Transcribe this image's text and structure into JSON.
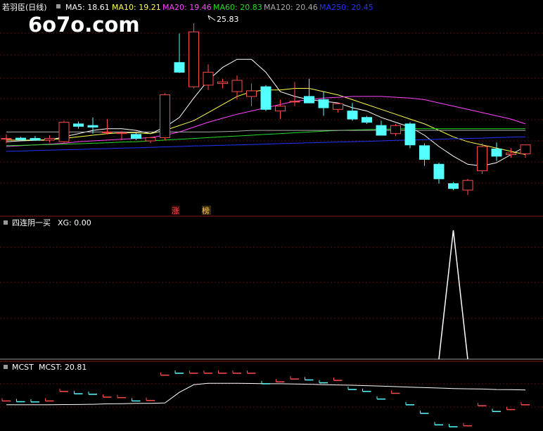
{
  "colors": {
    "background": "#000000",
    "up": "#ff4b4b",
    "down": "#54ffff",
    "ma5": "#ffffff",
    "ma10": "#ffff4d",
    "ma20": "#ff44ff",
    "ma60": "#22dd22",
    "ma120": "#aaaaaa",
    "ma250": "#2233ff",
    "divider": "#8b1a1a",
    "grid": "#5a1010"
  },
  "watermark": "6o7o.com",
  "main_panel": {
    "title": "若羽臣(日线)",
    "legends": [
      {
        "key": "ma5",
        "text": "MA5: 18.61"
      },
      {
        "key": "ma10",
        "text": "MA10: 19.21"
      },
      {
        "key": "ma20",
        "text": "MA20: 19.46"
      },
      {
        "key": "ma60",
        "text": "MA60: 20.83"
      },
      {
        "key": "ma120",
        "text": "MA120: 20.46"
      },
      {
        "key": "ma250",
        "text": "MA250: 20.45"
      }
    ],
    "high_annotation": "25.83",
    "event_marks": [
      "涨",
      "榜"
    ]
  },
  "indicator_panel": {
    "title": "四连阴一买",
    "legend": "XG: 0.00"
  },
  "mcst_panel": {
    "title": "MCST",
    "legend": "MCST: 20.81"
  },
  "chart_data": {
    "type": "candlestick",
    "price_range": [
      14.8,
      26.4
    ],
    "candles": [
      {
        "o": 18.65,
        "h": 18.95,
        "l": 18.4,
        "c": 18.7
      },
      {
        "o": 18.72,
        "h": 18.8,
        "l": 18.55,
        "c": 18.62
      },
      {
        "o": 18.7,
        "h": 18.85,
        "l": 18.55,
        "c": 18.6
      },
      {
        "o": 18.6,
        "h": 18.9,
        "l": 18.45,
        "c": 18.7
      },
      {
        "o": 18.5,
        "h": 19.8,
        "l": 18.4,
        "c": 19.7
      },
      {
        "o": 19.6,
        "h": 19.75,
        "l": 19.3,
        "c": 19.45
      },
      {
        "o": 19.5,
        "h": 20.0,
        "l": 19.0,
        "c": 19.4
      },
      {
        "o": 19.05,
        "h": 19.9,
        "l": 18.95,
        "c": 19.1
      },
      {
        "o": 19.0,
        "h": 19.15,
        "l": 18.6,
        "c": 19.05
      },
      {
        "o": 18.95,
        "h": 19.1,
        "l": 18.6,
        "c": 18.7
      },
      {
        "o": 18.55,
        "h": 18.8,
        "l": 18.4,
        "c": 18.75
      },
      {
        "o": 18.75,
        "h": 21.5,
        "l": 18.6,
        "c": 21.4
      },
      {
        "o": 23.4,
        "h": 25.2,
        "l": 22.75,
        "c": 22.8
      },
      {
        "o": 21.9,
        "h": 25.83,
        "l": 21.8,
        "c": 25.3
      },
      {
        "o": 22.0,
        "h": 23.3,
        "l": 21.7,
        "c": 22.8
      },
      {
        "o": 22.1,
        "h": 22.4,
        "l": 21.8,
        "c": 22.2
      },
      {
        "o": 21.6,
        "h": 22.6,
        "l": 21.1,
        "c": 22.3
      },
      {
        "o": 21.3,
        "h": 22.1,
        "l": 20.7,
        "c": 21.65
      },
      {
        "o": 21.9,
        "h": 22.0,
        "l": 20.4,
        "c": 20.5
      },
      {
        "o": 20.4,
        "h": 21.1,
        "l": 19.9,
        "c": 20.7
      },
      {
        "o": 21.0,
        "h": 22.2,
        "l": 20.7,
        "c": 21.0
      },
      {
        "o": 21.3,
        "h": 22.4,
        "l": 21.0,
        "c": 20.9
      },
      {
        "o": 21.1,
        "h": 21.6,
        "l": 20.1,
        "c": 20.6
      },
      {
        "o": 20.5,
        "h": 20.9,
        "l": 20.3,
        "c": 20.85
      },
      {
        "o": 20.4,
        "h": 20.9,
        "l": 19.8,
        "c": 19.9
      },
      {
        "o": 20.0,
        "h": 20.1,
        "l": 19.6,
        "c": 19.7
      },
      {
        "o": 19.5,
        "h": 19.8,
        "l": 18.95,
        "c": 18.9
      },
      {
        "o": 19.0,
        "h": 19.6,
        "l": 18.85,
        "c": 19.5
      },
      {
        "o": 19.6,
        "h": 19.7,
        "l": 18.1,
        "c": 18.3
      },
      {
        "o": 18.25,
        "h": 18.4,
        "l": 17.0,
        "c": 17.4
      },
      {
        "o": 17.1,
        "h": 17.2,
        "l": 15.9,
        "c": 16.2
      },
      {
        "o": 15.9,
        "h": 16.0,
        "l": 15.5,
        "c": 15.6
      },
      {
        "o": 15.5,
        "h": 16.2,
        "l": 15.2,
        "c": 16.1
      },
      {
        "o": 16.7,
        "h": 18.4,
        "l": 16.5,
        "c": 18.2
      },
      {
        "o": 18.05,
        "h": 18.45,
        "l": 17.3,
        "c": 17.6
      },
      {
        "o": 17.7,
        "h": 18.1,
        "l": 17.5,
        "c": 17.8
      },
      {
        "o": 17.75,
        "h": 18.3,
        "l": 17.5,
        "c": 18.3
      }
    ],
    "ma_series": [
      {
        "name": "MA5",
        "key": "ma5",
        "values": [
          18.5,
          18.55,
          18.58,
          18.6,
          18.8,
          19.0,
          19.2,
          19.3,
          19.3,
          19.2,
          19.0,
          19.4,
          20.0,
          21.2,
          22.3,
          23.1,
          23.6,
          23.6,
          22.8,
          21.6,
          21.3,
          21.1,
          21.0,
          20.9,
          20.6,
          20.4,
          20.0,
          19.7,
          19.4,
          18.9,
          18.2,
          17.6,
          17.1,
          17.0,
          17.2,
          17.7,
          18.2
        ]
      },
      {
        "name": "MA10",
        "key": "ma10",
        "values": [
          18.6,
          18.6,
          18.6,
          18.62,
          18.7,
          18.8,
          18.9,
          19.0,
          19.05,
          19.05,
          19.0,
          19.2,
          19.5,
          19.8,
          20.3,
          20.8,
          21.3,
          21.6,
          21.7,
          21.7,
          21.8,
          21.8,
          21.6,
          21.4,
          21.1,
          20.8,
          20.5,
          20.2,
          19.9,
          19.6,
          19.2,
          18.8,
          18.5,
          18.3,
          18.1,
          17.9,
          17.7
        ]
      },
      {
        "name": "MA20",
        "key": "ma20",
        "values": [
          18.2,
          18.25,
          18.3,
          18.35,
          18.4,
          18.5,
          18.55,
          18.6,
          18.65,
          18.7,
          18.75,
          18.9,
          19.1,
          19.4,
          19.7,
          19.95,
          20.2,
          20.4,
          20.6,
          20.8,
          21.0,
          21.1,
          21.2,
          21.25,
          21.3,
          21.3,
          21.3,
          21.25,
          21.2,
          21.1,
          20.9,
          20.7,
          20.5,
          20.3,
          20.1,
          19.9,
          19.6
        ]
      },
      {
        "name": "MA60",
        "key": "ma60",
        "values": [
          18.25,
          18.27,
          18.3,
          18.32,
          18.35,
          18.37,
          18.4,
          18.43,
          18.47,
          18.5,
          18.55,
          18.6,
          18.65,
          18.7,
          18.75,
          18.8,
          18.85,
          18.9,
          18.95,
          19.0,
          19.05,
          19.1,
          19.15,
          19.2,
          19.22,
          19.25,
          19.27,
          19.28,
          19.3,
          19.3,
          19.3,
          19.3,
          19.3,
          19.3,
          19.3,
          19.3,
          19.3
        ]
      },
      {
        "name": "MA120",
        "key": "ma120",
        "values": [
          19.1,
          19.1,
          19.1,
          19.1,
          19.1,
          19.1,
          19.1,
          19.1,
          19.1,
          19.1,
          19.1,
          19.1,
          19.1,
          19.1,
          19.1,
          19.12,
          19.15,
          19.2,
          19.2,
          19.2,
          19.2,
          19.2,
          19.2,
          19.2,
          19.2,
          19.2,
          19.2,
          19.2,
          19.2,
          19.2,
          19.2,
          19.2,
          19.2,
          19.2,
          19.2,
          19.2,
          19.2
        ]
      },
      {
        "name": "MA250",
        "key": "ma250",
        "values": [
          17.9,
          17.92,
          17.95,
          17.97,
          18.0,
          18.02,
          18.05,
          18.07,
          18.1,
          18.12,
          18.15,
          18.18,
          18.2,
          18.23,
          18.25,
          18.28,
          18.3,
          18.32,
          18.35,
          18.38,
          18.4,
          18.43,
          18.45,
          18.48,
          18.5,
          18.52,
          18.55,
          18.58,
          18.6,
          18.62,
          18.65,
          18.68,
          18.7,
          18.72,
          18.75,
          18.78,
          18.8
        ]
      }
    ],
    "indicator": {
      "name": "XG",
      "range": [
        0,
        1
      ],
      "values": [
        0,
        0,
        0,
        0,
        0,
        0,
        0,
        0,
        0,
        0,
        0,
        0,
        0,
        0,
        0,
        0,
        0,
        0,
        0,
        0,
        0,
        0,
        0,
        0,
        0,
        0,
        0,
        0,
        0,
        0,
        0,
        1,
        0,
        0,
        0,
        0,
        0
      ]
    },
    "mcst": {
      "range": [
        16.0,
        21.6
      ],
      "values": [
        18.3,
        18.3,
        18.3,
        18.3,
        18.32,
        18.33,
        18.35,
        18.4,
        18.42,
        18.45,
        18.45,
        18.5,
        19.6,
        20.4,
        20.55,
        20.55,
        20.55,
        20.53,
        20.5,
        20.5,
        20.48,
        20.45,
        20.4,
        20.38,
        20.35,
        20.3,
        20.25,
        20.2,
        20.15,
        20.1,
        20.05,
        20.0,
        19.97,
        19.95,
        19.9,
        19.88,
        19.85
      ]
    }
  }
}
